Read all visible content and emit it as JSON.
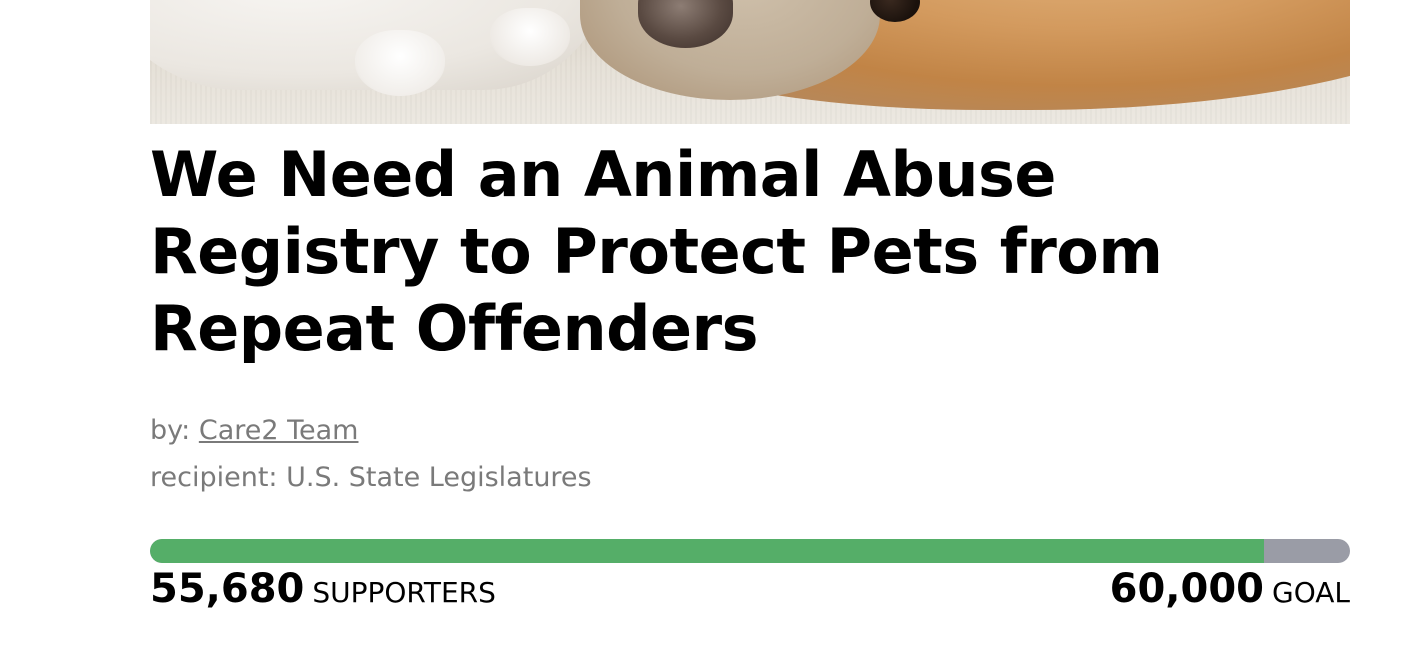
{
  "hero": {
    "image_icon": "dog-and-kitten-photo"
  },
  "petition": {
    "title": "We Need an Animal Abuse Registry to Protect Pets from Repeat Offenders",
    "author_prefix": "by:",
    "author_name": "Care2 Team",
    "recipient": "recipient: U.S. State Legislatures"
  },
  "progress": {
    "supporters": "55,680",
    "supporters_label": "SUPPORTERS",
    "goal": "60,000",
    "goal_label": "GOAL",
    "fraction": 0.928,
    "fill_color": "#55ae68",
    "track_color": "#9a9ca6"
  }
}
